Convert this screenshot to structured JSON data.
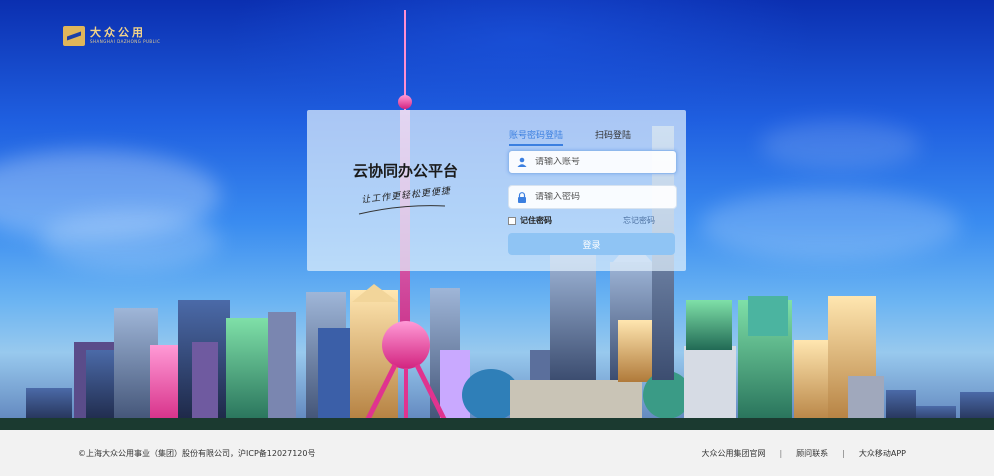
{
  "logo": {
    "name_cn": "大众公用",
    "name_en": "SHANGHAI DAZHONG PUBLIC"
  },
  "login": {
    "platform_title": "云协同办公平台",
    "slogan": "让工作更轻松更便捷",
    "tabs": [
      {
        "label": "账号密码登陆",
        "active": true
      },
      {
        "label": "扫码登陆",
        "active": false
      }
    ],
    "account_placeholder": "请输入账号",
    "password_placeholder": "请输入密码",
    "remember_label": "记住密码",
    "forgot_label": "忘记密码",
    "submit_label": "登录"
  },
  "footer": {
    "copyright": "©上海大众公用事业（集团）股份有限公司，沪ICP备12027120号",
    "links": [
      "大众公用集团官网",
      "顾问联系",
      "大众移动APP"
    ]
  },
  "colors": {
    "accent": "#3b7fe0",
    "button": "#8fc4f4",
    "logo_gold": "#e0b65a"
  }
}
